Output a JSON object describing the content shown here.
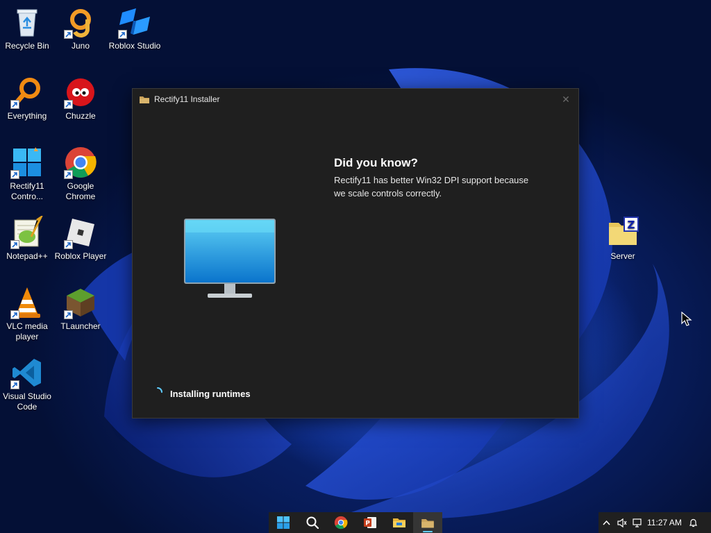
{
  "desktop": {
    "icons": [
      {
        "label": "Recycle Bin",
        "icon": "recycle-bin-icon"
      },
      {
        "label": "Juno",
        "icon": "juno-icon"
      },
      {
        "label": "Roblox Studio",
        "icon": "roblox-studio-icon"
      },
      {
        "label": "Everything",
        "icon": "everything-search-icon"
      },
      {
        "label": "Chuzzle",
        "icon": "chuzzle-icon"
      },
      {
        "label": "Rectify11 Contro...",
        "icon": "rectify11-control-icon"
      },
      {
        "label": "Google Chrome",
        "icon": "chrome-icon"
      },
      {
        "label": "Notepad++",
        "icon": "notepad-plus-plus-icon"
      },
      {
        "label": "Roblox Player",
        "icon": "roblox-player-icon"
      },
      {
        "label": "VLC media player",
        "icon": "vlc-icon"
      },
      {
        "label": "TLauncher",
        "icon": "tlauncher-icon"
      },
      {
        "label": "Visual Studio Code",
        "icon": "vscode-icon"
      },
      {
        "label": "Server",
        "icon": "server-folder-icon"
      }
    ]
  },
  "installer": {
    "title": "Rectify11 Installer",
    "close_label": "✕",
    "tip_heading": "Did you know?",
    "tip_body": "Rectify11 has better Win32 DPI support because we scale controls correctly.",
    "status": "Installing runtimes"
  },
  "taskbar": {
    "items": [
      "start-icon",
      "search-icon",
      "chrome-icon",
      "powerpoint-icon",
      "file-explorer-icon",
      "installer-icon"
    ]
  },
  "tray": {
    "time": "11:27 AM",
    "chevron": "^"
  },
  "colors": {
    "accent": "#60cdff",
    "window_bg": "#1f1f1f",
    "taskbar_bg": "#202020"
  }
}
